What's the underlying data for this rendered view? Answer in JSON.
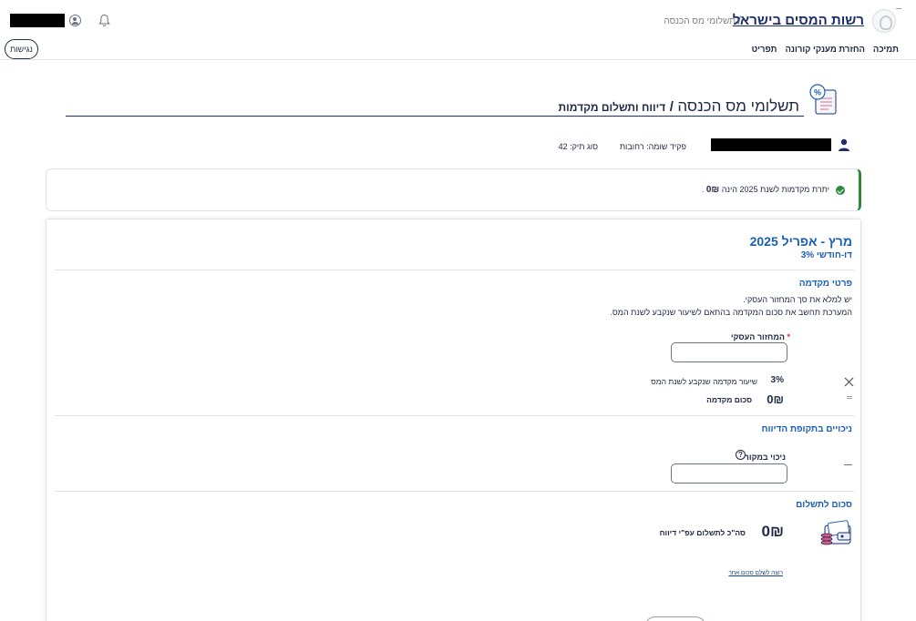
{
  "header": {
    "site_title": "רשות המסים בישראל",
    "breadcrumb_separator": "/",
    "breadcrumb_current": "תשלומי מס הכנסה",
    "nav": [
      "תפריט",
      "החזרת מענקי קורונה",
      "תמיכה"
    ],
    "accessibility_label": "נגישות"
  },
  "page": {
    "title_light": "תשלומי מס הכנסה",
    "title_sep": "/",
    "title_bold": "דיווח ותשלום מקדמות"
  },
  "taxpayer": {
    "office": "פקיד שומה: רחובות",
    "file_type": "סוג תיק: 42"
  },
  "alert": {
    "text_prefix": "יתרת מקדמות לשנת 2025 הינה",
    "amount": "0₪",
    "text_suffix": "."
  },
  "period": {
    "title": "מרץ - אפריל 2025",
    "subtitle": "דו-חודשי 3%"
  },
  "advance_details": {
    "title": "פרטי מקדמה",
    "desc_line1": "יש למלא את סך המחזור העסקי.",
    "desc_line2": "המערכת תחשב את סכום המקדמה בהתאם לשיעור שנקבע לשנת המס.",
    "turnover_required": "*",
    "turnover_label": "המחזור העסקי",
    "turnover_value": "",
    "rate_value": "3%",
    "rate_label": "שיעור מקדמה שנקבע לשנת המס",
    "advance_amount": "0₪",
    "advance_label": "סכום מקדמה"
  },
  "deductions": {
    "title": "ניכויים בתקופת הדיווח",
    "withholding_label": "ניכוי במקור",
    "withholding_value": "",
    "help_glyph": "?"
  },
  "payment": {
    "title": "סכום לתשלום",
    "total_amount": "0₪",
    "total_label": "סה\"כ לתשלום עפ\"י דיווח",
    "other_amount_link": "רוצה לשלם סכום אחר"
  },
  "colors": {
    "primary_blue": "#1a5fb4",
    "navy": "#1c2f6b",
    "success_green": "#2e8b3a"
  },
  "icons": {
    "logo": "logo-icon",
    "user": "user-circle-icon",
    "bell": "bell-icon",
    "page": "percent-document-icon",
    "person": "person-icon",
    "check": "check-circle-icon",
    "close": "x-icon",
    "equals": "equals-icon",
    "help": "question-circle-icon",
    "minus": "minus-icon",
    "wallet": "wallet-coins-icon"
  }
}
